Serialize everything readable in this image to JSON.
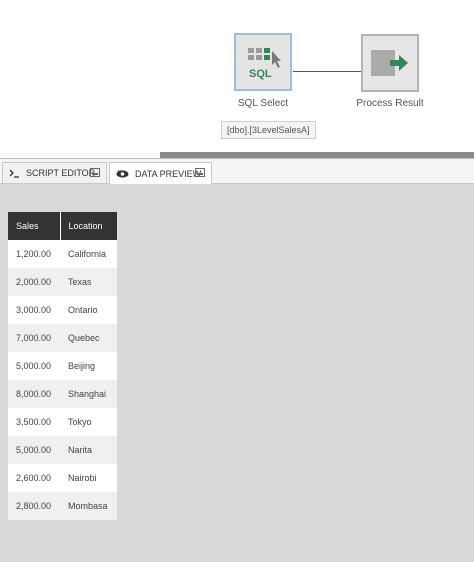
{
  "workflow": {
    "sql_node": {
      "icon_text": "SQL",
      "label": "SQL Select",
      "tooltip": "[dbo].[3LevelSalesA]"
    },
    "result_node": {
      "label": "Process Result"
    }
  },
  "tabs": [
    {
      "label": "SCRIPT EDITOR",
      "icon": "terminal-icon",
      "active": false
    },
    {
      "label": "DATA PREVIEW",
      "icon": "eye-icon",
      "active": true
    }
  ],
  "preview": {
    "columns": [
      "Sales",
      "Location"
    ],
    "rows": [
      [
        "1,200.00",
        "California"
      ],
      [
        "2,000.00",
        "Texas"
      ],
      [
        "3,000.00",
        "Ontario"
      ],
      [
        "7,000.00",
        "Quebec"
      ],
      [
        "5,000.00",
        "Beijing"
      ],
      [
        "8,000.00",
        "Shanghai"
      ],
      [
        "3,500.00",
        "Tokyo"
      ],
      [
        "5,000.00",
        "Narita"
      ],
      [
        "2,600.00",
        "Nairobi"
      ],
      [
        "2,800.00",
        "Mombasa"
      ]
    ]
  },
  "colors": {
    "accent_green": "#2e8b57",
    "header_bg": "#333333",
    "panel_bg": "#d9d9d9"
  }
}
